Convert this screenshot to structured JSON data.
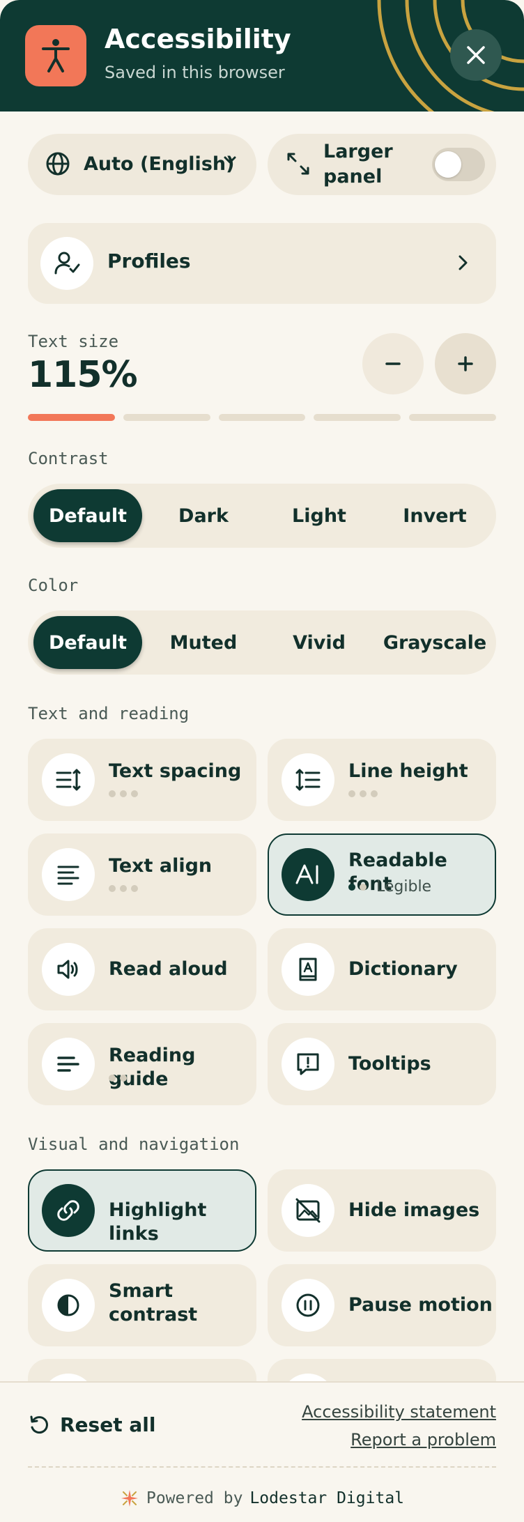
{
  "header": {
    "title": "Accessibility",
    "subtitle": "Saved in this browser",
    "colors": {
      "background": "#0e3a33",
      "accent": "#f27758",
      "rings": "#c9a340"
    }
  },
  "language": {
    "value": "Auto (English)"
  },
  "larger_panel": {
    "label": "Larger panel",
    "enabled": false
  },
  "profiles": {
    "label": "Profiles"
  },
  "text_size": {
    "label": "Text size",
    "value": "115%",
    "level": 1,
    "levels": 5
  },
  "contrast": {
    "label": "Contrast",
    "options": [
      "Default",
      "Dark",
      "Light",
      "Invert"
    ],
    "selected": "Default"
  },
  "color": {
    "label": "Color",
    "options": [
      "Default",
      "Muted",
      "Vivid",
      "Grayscale"
    ],
    "selected": "Default"
  },
  "text_reading": {
    "label": "Text and reading",
    "items": [
      {
        "label": "Text spacing",
        "icon": "text-spacing-icon",
        "active": false
      },
      {
        "label": "Line height",
        "icon": "line-height-icon",
        "active": false
      },
      {
        "label": "Text align",
        "icon": "text-align-icon",
        "active": false
      },
      {
        "label": "Readable font",
        "icon": "readable-font-icon",
        "active": true,
        "status": "Legible"
      },
      {
        "label": "Read aloud",
        "icon": "speaker-icon",
        "active": false
      },
      {
        "label": "Dictionary",
        "icon": "dictionary-icon",
        "active": false
      },
      {
        "label": "Reading guide",
        "icon": "reading-guide-icon",
        "active": false
      },
      {
        "label": "Tooltips",
        "icon": "tooltip-icon",
        "active": false
      }
    ]
  },
  "visual_navigation": {
    "label": "Visual and navigation",
    "items": [
      {
        "label": "Highlight links",
        "icon": "link-icon",
        "active": true
      },
      {
        "label": "Hide images",
        "icon": "hide-image-icon",
        "active": false
      },
      {
        "label": "Smart contrast",
        "icon": "contrast-icon",
        "active": false
      },
      {
        "label": "Pause motion",
        "icon": "pause-icon",
        "active": false
      }
    ]
  },
  "footer": {
    "reset_label": "Reset all",
    "statement_link": "Accessibility statement",
    "report_link": "Report a problem",
    "powered_by": "Powered by",
    "brand": "Lodestar Digital"
  }
}
